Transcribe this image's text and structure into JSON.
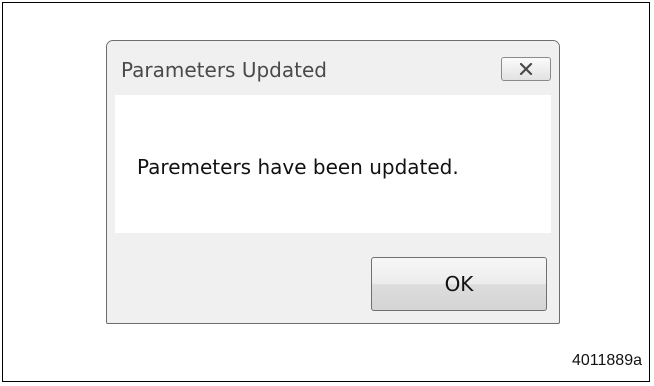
{
  "dialog": {
    "title": "Parameters Updated",
    "message": "Paremeters have been updated.",
    "ok_label": "OK",
    "close_icon": "close-icon"
  },
  "figure": {
    "id": "4011889a"
  }
}
